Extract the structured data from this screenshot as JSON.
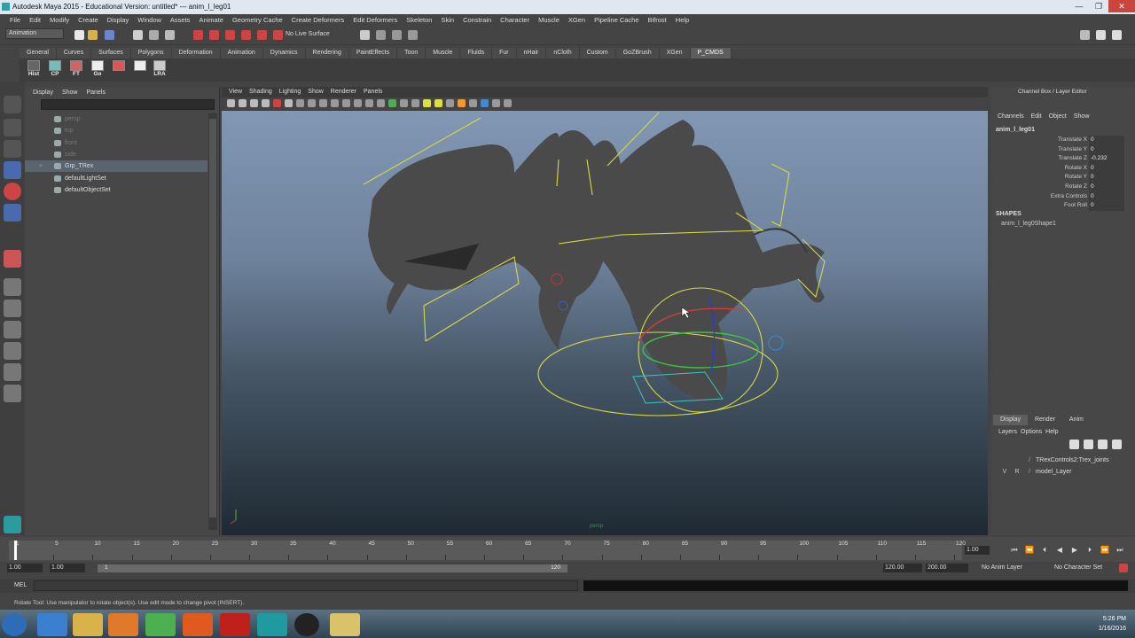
{
  "title": "Autodesk Maya 2015 - Educational Version: untitled*   ---   anim_l_leg01",
  "window_controls": [
    "—",
    "❐",
    "✕"
  ],
  "menubar": [
    "File",
    "Edit",
    "Modify",
    "Create",
    "Display",
    "Window",
    "Assets",
    "Animate",
    "Geometry Cache",
    "Create Deformers",
    "Edit Deformers",
    "Skeleton",
    "Skin",
    "Constrain",
    "Character",
    "Muscle",
    "XGen",
    "Pipeline Cache",
    "Bifrost",
    "Help"
  ],
  "status": {
    "mode": "Animation",
    "live_surface": "No Live Surface"
  },
  "shelf_tabs": [
    "General",
    "Curves",
    "Surfaces",
    "Polygons",
    "Deformation",
    "Animation",
    "Dynamics",
    "Rendering",
    "PaintEffects",
    "Toon",
    "Muscle",
    "Fluids",
    "Fur",
    "nHair",
    "nCloth",
    "Custom",
    "GoZBrush",
    "XGen",
    "P_CMDS"
  ],
  "shelf_active": "P_CMDS",
  "shelf_buttons": [
    "Hist",
    "CP",
    "FT",
    "Go",
    "",
    "LRA"
  ],
  "outliner": {
    "menu": [
      "Display",
      "Show",
      "Panels"
    ],
    "items": [
      {
        "label": "persp",
        "dim": true
      },
      {
        "label": "top",
        "dim": true
      },
      {
        "label": "front",
        "dim": true
      },
      {
        "label": "side",
        "dim": true
      },
      {
        "label": "Grp_TRex",
        "dim": false,
        "selected": true
      },
      {
        "label": "defaultLightSet",
        "dim": false
      },
      {
        "label": "defaultObjectSet",
        "dim": false
      }
    ]
  },
  "viewport": {
    "menu": [
      "View",
      "Shading",
      "Lighting",
      "Show",
      "Renderer",
      "Panels"
    ],
    "camera_label": "persp"
  },
  "channel_box": {
    "title": "Channel Box / Layer Editor",
    "menu": [
      "Channels",
      "Edit",
      "Object",
      "Show"
    ],
    "node": "anim_l_leg01",
    "attributes": [
      {
        "name": "Translate X",
        "value": "0"
      },
      {
        "name": "Translate Y",
        "value": "0"
      },
      {
        "name": "Translate Z",
        "value": "-0.232"
      },
      {
        "name": "Rotate X",
        "value": "0"
      },
      {
        "name": "Rotate Y",
        "value": "0"
      },
      {
        "name": "Rotate Z",
        "value": "0"
      },
      {
        "name": "Extra Controls",
        "value": "0"
      },
      {
        "name": "Foot Roll",
        "value": "0"
      }
    ],
    "shapes_header": "SHAPES",
    "shape": "anim_l_leg0Shape1"
  },
  "layer_editor": {
    "tabs": [
      "Display",
      "Render",
      "Anim"
    ],
    "active_tab": "Display",
    "menu": [
      "Layers",
      "Options",
      "Help"
    ],
    "layers": [
      {
        "v": "",
        "r": "",
        "name": "TRexControls2:Trex_joints"
      },
      {
        "v": "V",
        "r": "R",
        "name": "model_Layer"
      }
    ]
  },
  "timeline": {
    "ticks": [
      "1",
      "5",
      "10",
      "15",
      "20",
      "25",
      "30",
      "35",
      "40",
      "45",
      "50",
      "55",
      "60",
      "65",
      "70",
      "75",
      "80",
      "85",
      "90",
      "95",
      "100",
      "105",
      "110",
      "115",
      "120"
    ],
    "current_frame": "1.00",
    "playback_buttons": [
      "⏮",
      "⏪",
      "⏴",
      "◀",
      "▶",
      "⏵",
      "⏩",
      "⏭"
    ]
  },
  "range": {
    "start": "1.00",
    "start_inner": "1.00",
    "slider_start": "1",
    "slider_end": "120",
    "end_inner": "120.00",
    "end": "200.00",
    "anim_layer": "No Anim Layer",
    "character_set": "No Character Set"
  },
  "mel_label": "MEL",
  "help_line": "Rotate Tool: Use manipulator to rotate object(s). Use edit mode to change pivot (INSERT).",
  "clock": {
    "time": "5:26 PM",
    "date": "1/16/2016"
  }
}
